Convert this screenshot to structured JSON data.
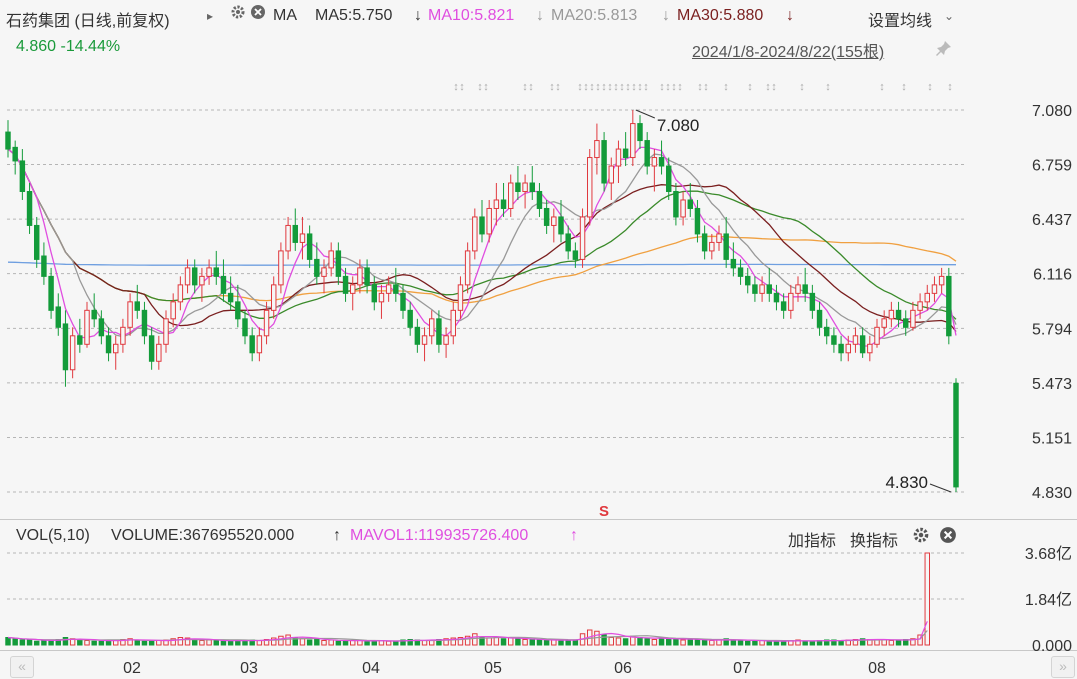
{
  "header": {
    "title": "石药集团 (日线,前复权)",
    "indicator": "MA",
    "ma5": "MA5:5.750",
    "ma10": "MA10:5.821",
    "ma20": "MA20:5.813",
    "ma30": "MA30:5.880",
    "settings_label": "设置均线",
    "price_change": "4.860 -14.44%",
    "date_range": "2024/1/8-2024/8/22(155根)"
  },
  "volume_header": {
    "label": "VOL(5,10)",
    "volume": "VOLUME:367695520.000",
    "mavol1": "MAVOL1:119935726.400",
    "add_indicator": "加指标",
    "switch_indicator": "换指标"
  },
  "colors": {
    "up": "#e0393e",
    "down": "#139b3a",
    "ma5": "#e04ee0",
    "ma10": "#999999",
    "ma20": "#7a1f1f",
    "ma30": "#3a8a2a",
    "ma60": "#f0a040",
    "ma120": "#6f9fe0",
    "text_up": "#e0393e",
    "text_green": "#1a9a3a"
  },
  "icons": {
    "gear": "gear-icon",
    "close": "close-icon",
    "pin": "pin-icon",
    "arrow": "down-arrow-icon",
    "marker": "s-marker-icon",
    "nav_left": "double-left-icon",
    "nav_right": "double-right-icon"
  },
  "chart_data": {
    "type": "candlestick",
    "price_axis": {
      "ticks": [
        "7.080",
        "6.759",
        "6.437",
        "6.116",
        "5.794",
        "5.473",
        "5.151",
        "4.830"
      ],
      "range": [
        4.83,
        7.08
      ]
    },
    "volume_axis": {
      "ticks": [
        "3.68亿",
        "1.84亿",
        "0.000"
      ],
      "range": [
        0,
        3.68
      ]
    },
    "x_labels": [
      "02",
      "03",
      "04",
      "05",
      "06",
      "07",
      "08"
    ],
    "annotations": {
      "high": "7.080",
      "low": "4.830"
    },
    "candles": [
      [
        6.95,
        7.02,
        6.8,
        6.85
      ],
      [
        6.86,
        6.9,
        6.7,
        6.78
      ],
      [
        6.78,
        6.85,
        6.55,
        6.6
      ],
      [
        6.6,
        6.65,
        6.35,
        6.4
      ],
      [
        6.4,
        6.45,
        6.15,
        6.2
      ],
      [
        6.22,
        6.3,
        6.05,
        6.1
      ],
      [
        6.1,
        6.15,
        5.85,
        5.9
      ],
      [
        5.92,
        6,
        5.75,
        5.8
      ],
      [
        5.82,
        5.9,
        5.45,
        5.55
      ],
      [
        5.55,
        5.8,
        5.5,
        5.75
      ],
      [
        5.75,
        5.85,
        5.65,
        5.7
      ],
      [
        5.7,
        5.95,
        5.68,
        5.9
      ],
      [
        5.9,
        6,
        5.8,
        5.85
      ],
      [
        5.85,
        5.9,
        5.7,
        5.75
      ],
      [
        5.75,
        5.8,
        5.6,
        5.65
      ],
      [
        5.65,
        5.75,
        5.55,
        5.7
      ],
      [
        5.7,
        5.85,
        5.65,
        5.8
      ],
      [
        5.8,
        6,
        5.75,
        5.95
      ],
      [
        5.95,
        6.05,
        5.85,
        5.9
      ],
      [
        5.9,
        5.95,
        5.7,
        5.75
      ],
      [
        5.75,
        5.8,
        5.55,
        5.6
      ],
      [
        5.6,
        5.75,
        5.55,
        5.7
      ],
      [
        5.7,
        5.9,
        5.65,
        5.85
      ],
      [
        5.85,
        6,
        5.8,
        5.95
      ],
      [
        5.95,
        6.1,
        5.9,
        6.05
      ],
      [
        6.05,
        6.2,
        6,
        6.15
      ],
      [
        6.15,
        6.2,
        6,
        6.05
      ],
      [
        6.05,
        6.15,
        5.95,
        6.1
      ],
      [
        6.1,
        6.2,
        6.05,
        6.15
      ],
      [
        6.15,
        6.25,
        6.05,
        6.1
      ],
      [
        6.1,
        6.2,
        5.95,
        6
      ],
      [
        6,
        6.1,
        5.9,
        5.95
      ],
      [
        5.95,
        6.05,
        5.8,
        5.85
      ],
      [
        5.85,
        5.9,
        5.7,
        5.75
      ],
      [
        5.75,
        5.8,
        5.6,
        5.65
      ],
      [
        5.65,
        5.8,
        5.6,
        5.75
      ],
      [
        5.75,
        5.95,
        5.7,
        5.9
      ],
      [
        5.9,
        6.1,
        5.85,
        6.05
      ],
      [
        6.05,
        6.3,
        6,
        6.25
      ],
      [
        6.25,
        6.45,
        6.2,
        6.4
      ],
      [
        6.4,
        6.5,
        6.25,
        6.3
      ],
      [
        6.3,
        6.45,
        6.2,
        6.35
      ],
      [
        6.35,
        6.4,
        6.15,
        6.2
      ],
      [
        6.2,
        6.3,
        6.05,
        6.1
      ],
      [
        6.1,
        6.2,
        6,
        6.15
      ],
      [
        6.15,
        6.3,
        6.1,
        6.25
      ],
      [
        6.25,
        6.3,
        6.05,
        6.1
      ],
      [
        6.1,
        6.15,
        5.95,
        6
      ],
      [
        6,
        6.1,
        5.9,
        6.05
      ],
      [
        6.05,
        6.2,
        6,
        6.15
      ],
      [
        6.15,
        6.2,
        6,
        6.05
      ],
      [
        6.05,
        6.1,
        5.9,
        5.95
      ],
      [
        5.95,
        6.05,
        5.85,
        6
      ],
      [
        6,
        6.1,
        5.95,
        6.05
      ],
      [
        6.05,
        6.15,
        5.95,
        6
      ],
      [
        6,
        6.05,
        5.85,
        5.9
      ],
      [
        5.9,
        5.95,
        5.75,
        5.8
      ],
      [
        5.8,
        5.85,
        5.65,
        5.7
      ],
      [
        5.7,
        5.8,
        5.6,
        5.75
      ],
      [
        5.75,
        5.9,
        5.7,
        5.85
      ],
      [
        5.85,
        5.9,
        5.65,
        5.7
      ],
      [
        5.7,
        5.8,
        5.62,
        5.75
      ],
      [
        5.75,
        5.95,
        5.7,
        5.9
      ],
      [
        5.9,
        6.1,
        5.85,
        6.05
      ],
      [
        6.05,
        6.3,
        6,
        6.25
      ],
      [
        6.25,
        6.5,
        6.2,
        6.45
      ],
      [
        6.45,
        6.55,
        6.3,
        6.35
      ],
      [
        6.35,
        6.55,
        6.3,
        6.5
      ],
      [
        6.5,
        6.65,
        6.4,
        6.55
      ],
      [
        6.55,
        6.65,
        6.45,
        6.5
      ],
      [
        6.5,
        6.7,
        6.45,
        6.65
      ],
      [
        6.65,
        6.75,
        6.55,
        6.6
      ],
      [
        6.6,
        6.7,
        6.5,
        6.65
      ],
      [
        6.65,
        6.75,
        6.55,
        6.6
      ],
      [
        6.6,
        6.65,
        6.45,
        6.5
      ],
      [
        6.5,
        6.55,
        6.35,
        6.4
      ],
      [
        6.4,
        6.5,
        6.3,
        6.45
      ],
      [
        6.45,
        6.55,
        6.3,
        6.35
      ],
      [
        6.35,
        6.4,
        6.2,
        6.25
      ],
      [
        6.25,
        6.3,
        6.15,
        6.2
      ],
      [
        6.2,
        6.5,
        6.15,
        6.45
      ],
      [
        6.45,
        6.85,
        6.4,
        6.8
      ],
      [
        6.8,
        7,
        6.7,
        6.9
      ],
      [
        6.9,
        6.95,
        6.6,
        6.65
      ],
      [
        6.65,
        6.8,
        6.55,
        6.75
      ],
      [
        6.75,
        6.9,
        6.65,
        6.85
      ],
      [
        6.85,
        6.95,
        6.75,
        6.8
      ],
      [
        6.8,
        7.08,
        6.75,
        7
      ],
      [
        7,
        7.05,
        6.85,
        6.9
      ],
      [
        6.9,
        6.95,
        6.7,
        6.75
      ],
      [
        6.75,
        6.85,
        6.6,
        6.8
      ],
      [
        6.8,
        6.9,
        6.7,
        6.75
      ],
      [
        6.75,
        6.8,
        6.55,
        6.6
      ],
      [
        6.6,
        6.65,
        6.4,
        6.45
      ],
      [
        6.45,
        6.6,
        6.4,
        6.55
      ],
      [
        6.55,
        6.65,
        6.45,
        6.5
      ],
      [
        6.5,
        6.55,
        6.3,
        6.35
      ],
      [
        6.35,
        6.4,
        6.2,
        6.25
      ],
      [
        6.25,
        6.35,
        6.2,
        6.3
      ],
      [
        6.3,
        6.4,
        6.25,
        6.35
      ],
      [
        6.35,
        6.45,
        6.15,
        6.2
      ],
      [
        6.2,
        6.3,
        6.1,
        6.15
      ],
      [
        6.15,
        6.2,
        6.05,
        6.1
      ],
      [
        6.1,
        6.15,
        6,
        6.05
      ],
      [
        6.05,
        6.1,
        5.95,
        6
      ],
      [
        6,
        6.1,
        5.95,
        6.05
      ],
      [
        6.05,
        6.15,
        5.95,
        6
      ],
      [
        6,
        6.05,
        5.9,
        5.95
      ],
      [
        5.95,
        6,
        5.85,
        5.9
      ],
      [
        5.9,
        6.05,
        5.85,
        6
      ],
      [
        6,
        6.1,
        5.95,
        6.05
      ],
      [
        6.05,
        6.15,
        5.95,
        6
      ],
      [
        6,
        6.05,
        5.85,
        5.9
      ],
      [
        5.9,
        5.95,
        5.75,
        5.8
      ],
      [
        5.8,
        5.85,
        5.7,
        5.75
      ],
      [
        5.75,
        5.8,
        5.65,
        5.7
      ],
      [
        5.7,
        5.75,
        5.6,
        5.65
      ],
      [
        5.65,
        5.75,
        5.6,
        5.7
      ],
      [
        5.7,
        5.8,
        5.65,
        5.75
      ],
      [
        5.75,
        5.8,
        5.62,
        5.65
      ],
      [
        5.65,
        5.75,
        5.6,
        5.7
      ],
      [
        5.7,
        5.85,
        5.68,
        5.8
      ],
      [
        5.8,
        5.9,
        5.75,
        5.85
      ],
      [
        5.85,
        5.95,
        5.8,
        5.9
      ],
      [
        5.9,
        5.95,
        5.8,
        5.85
      ],
      [
        5.85,
        5.9,
        5.75,
        5.8
      ],
      [
        5.8,
        5.95,
        5.78,
        5.9
      ],
      [
        5.9,
        6,
        5.85,
        5.95
      ],
      [
        5.95,
        6.05,
        5.9,
        6
      ],
      [
        6,
        6.1,
        5.95,
        6.05
      ],
      [
        6.05,
        6.15,
        6,
        6.1
      ],
      [
        6.1,
        6.15,
        5.7,
        5.75
      ],
      [
        5.47,
        5.5,
        4.83,
        4.86
      ]
    ],
    "volume_values": [
      0.3,
      0.25,
      0.2,
      0.2,
      0.15,
      0.18,
      0.2,
      0.22,
      0.3,
      0.25,
      0.2,
      0.18,
      0.15,
      0.15,
      0.2,
      0.18,
      0.22,
      0.25,
      0.2,
      0.15,
      0.15,
      0.18,
      0.2,
      0.25,
      0.3,
      0.28,
      0.2,
      0.18,
      0.2,
      0.18,
      0.15,
      0.15,
      0.18,
      0.2,
      0.2,
      0.18,
      0.22,
      0.28,
      0.35,
      0.4,
      0.3,
      0.25,
      0.2,
      0.22,
      0.18,
      0.2,
      0.15,
      0.15,
      0.18,
      0.2,
      0.15,
      0.15,
      0.18,
      0.15,
      0.15,
      0.2,
      0.22,
      0.2,
      0.18,
      0.2,
      0.22,
      0.25,
      0.28,
      0.3,
      0.35,
      0.45,
      0.3,
      0.28,
      0.3,
      0.25,
      0.28,
      0.25,
      0.22,
      0.2,
      0.2,
      0.18,
      0.2,
      0.2,
      0.18,
      0.2,
      0.45,
      0.6,
      0.55,
      0.4,
      0.3,
      0.28,
      0.25,
      0.35,
      0.3,
      0.25,
      0.22,
      0.25,
      0.28,
      0.25,
      0.2,
      0.2,
      0.22,
      0.18,
      0.18,
      0.2,
      0.25,
      0.2,
      0.18,
      0.15,
      0.15,
      0.18,
      0.15,
      0.15,
      0.15,
      0.18,
      0.2,
      0.15,
      0.15,
      0.18,
      0.2,
      0.2,
      0.18,
      0.2,
      0.22,
      0.25,
      0.22,
      0.2,
      0.2,
      0.18,
      0.2,
      0.22,
      0.25,
      0.4,
      3.68
    ]
  }
}
